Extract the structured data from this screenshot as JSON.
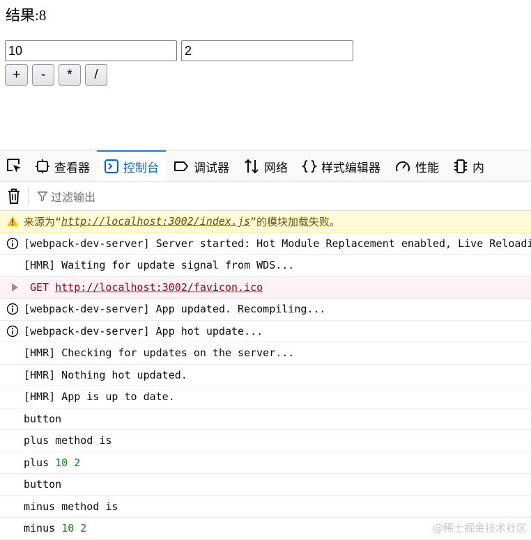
{
  "page": {
    "result_label": "结果:",
    "result_value": "8",
    "inputs": [
      {
        "value": "10"
      },
      {
        "value": "2"
      }
    ],
    "buttons": [
      "+",
      "-",
      "*",
      "/"
    ]
  },
  "devtools": {
    "tabs": [
      {
        "label": "查看器",
        "icon": "inspector-icon",
        "selected": false
      },
      {
        "label": "控制台",
        "icon": "console-icon",
        "selected": true
      },
      {
        "label": "调试器",
        "icon": "debugger-icon",
        "selected": false
      },
      {
        "label": "网络",
        "icon": "network-icon",
        "selected": false
      },
      {
        "label": "样式编辑器",
        "icon": "style-editor-icon",
        "selected": false
      },
      {
        "label": "性能",
        "icon": "performance-icon",
        "selected": false
      },
      {
        "label": "内",
        "icon": "memory-icon",
        "selected": false
      }
    ],
    "filter_placeholder": "过滤输出"
  },
  "console": {
    "rows": [
      {
        "kind": "warning",
        "parts": [
          {
            "text": "来源为“",
            "style": "text"
          },
          {
            "text": "http://localhost:3002/index.js",
            "style": "link"
          },
          {
            "text": "”的模块加载失败。",
            "style": "text"
          }
        ]
      },
      {
        "kind": "info",
        "parts": [
          {
            "text": "[webpack-dev-server] Server started: Hot Module Replacement enabled, Live Reloading enabled, Progress disabled, Overlay enabled.",
            "style": "text"
          }
        ]
      },
      {
        "kind": "log",
        "parts": [
          {
            "text": "[HMR] Waiting for update signal from WDS...",
            "style": "text"
          }
        ]
      },
      {
        "kind": "error",
        "parts": [
          {
            "text": "GET ",
            "style": "err"
          },
          {
            "text": "http://localhost:3002/favicon.ico",
            "style": "errlink"
          }
        ]
      },
      {
        "kind": "info",
        "parts": [
          {
            "text": "[webpack-dev-server] App updated. Recompiling...",
            "style": "text"
          }
        ]
      },
      {
        "kind": "info",
        "parts": [
          {
            "text": "[webpack-dev-server] App hot update...",
            "style": "text"
          }
        ]
      },
      {
        "kind": "log",
        "parts": [
          {
            "text": "[HMR] Checking for updates on the server...",
            "style": "text"
          }
        ]
      },
      {
        "kind": "log",
        "parts": [
          {
            "text": "[HMR] Nothing hot updated.",
            "style": "text"
          }
        ]
      },
      {
        "kind": "log",
        "parts": [
          {
            "text": "[HMR] App is up to date.",
            "style": "text"
          }
        ]
      },
      {
        "kind": "log",
        "parts": [
          {
            "text": "button",
            "style": "text"
          }
        ]
      },
      {
        "kind": "log",
        "parts": [
          {
            "text": "plus method is",
            "style": "text"
          }
        ]
      },
      {
        "kind": "log",
        "parts": [
          {
            "text": "plus ",
            "style": "text"
          },
          {
            "text": "10",
            "style": "num"
          },
          {
            "text": " ",
            "style": "text"
          },
          {
            "text": "2",
            "style": "num"
          }
        ]
      },
      {
        "kind": "log",
        "parts": [
          {
            "text": "button",
            "style": "text"
          }
        ]
      },
      {
        "kind": "log",
        "parts": [
          {
            "text": "minus method is",
            "style": "text"
          }
        ]
      },
      {
        "kind": "log",
        "parts": [
          {
            "text": "minus ",
            "style": "text"
          },
          {
            "text": "10",
            "style": "num"
          },
          {
            "text": " ",
            "style": "text"
          },
          {
            "text": "2",
            "style": "num"
          }
        ]
      }
    ]
  },
  "theme": {
    "accent": "#0060df",
    "warning_bg": "#fffbd6",
    "error_bg": "#fdf2f5",
    "number_color": "#058b00"
  },
  "watermark": "@稀土掘金技术社区"
}
